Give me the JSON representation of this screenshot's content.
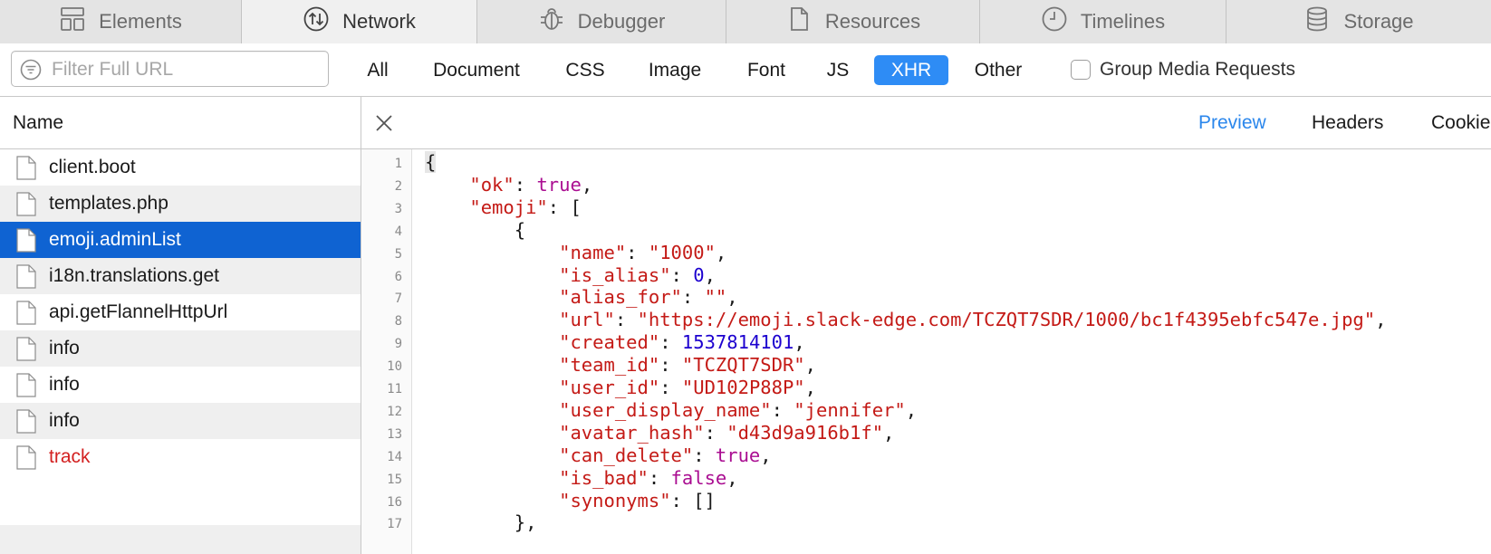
{
  "tabs": [
    {
      "label": "Elements",
      "icon": "elements-icon",
      "active": false
    },
    {
      "label": "Network",
      "icon": "network-icon",
      "active": true
    },
    {
      "label": "Debugger",
      "icon": "debugger-icon",
      "active": false
    },
    {
      "label": "Resources",
      "icon": "resources-icon",
      "active": false
    },
    {
      "label": "Timelines",
      "icon": "timelines-icon",
      "active": false
    },
    {
      "label": "Storage",
      "icon": "storage-icon",
      "active": false
    }
  ],
  "filter": {
    "placeholder": "Filter Full URL",
    "types": [
      "All",
      "Document",
      "CSS",
      "Image",
      "Font",
      "JS",
      "XHR",
      "Other"
    ],
    "active_type": "XHR",
    "group_media_label": "Group Media Requests",
    "group_media_checked": false
  },
  "list": {
    "header": "Name",
    "items": [
      {
        "name": "client.boot",
        "state": "normal"
      },
      {
        "name": "templates.php",
        "state": "normal"
      },
      {
        "name": "emoji.adminList",
        "state": "selected"
      },
      {
        "name": "i18n.translations.get",
        "state": "normal"
      },
      {
        "name": "api.getFlannelHttpUrl",
        "state": "normal"
      },
      {
        "name": "info",
        "state": "normal"
      },
      {
        "name": "info",
        "state": "normal"
      },
      {
        "name": "info",
        "state": "normal"
      },
      {
        "name": "track",
        "state": "error"
      }
    ]
  },
  "detail": {
    "tabs": [
      "Preview",
      "Headers",
      "Cookies"
    ],
    "active_tab": "Preview"
  },
  "code": {
    "line_numbers": [
      "1",
      "2",
      "3",
      "4",
      "5",
      "6",
      "7",
      "8",
      "9",
      "10",
      "11",
      "12",
      "13",
      "14",
      "15",
      "16",
      "17"
    ],
    "lines": [
      [
        {
          "t": "p",
          "v": "{"
        }
      ],
      [
        {
          "t": "p",
          "v": "    "
        },
        {
          "t": "k",
          "v": "\"ok\""
        },
        {
          "t": "p",
          "v": ": "
        },
        {
          "t": "b",
          "v": "true"
        },
        {
          "t": "p",
          "v": ","
        }
      ],
      [
        {
          "t": "p",
          "v": "    "
        },
        {
          "t": "k",
          "v": "\"emoji\""
        },
        {
          "t": "p",
          "v": ": ["
        }
      ],
      [
        {
          "t": "p",
          "v": "        {"
        }
      ],
      [
        {
          "t": "p",
          "v": "            "
        },
        {
          "t": "k",
          "v": "\"name\""
        },
        {
          "t": "p",
          "v": ": "
        },
        {
          "t": "s",
          "v": "\"1000\""
        },
        {
          "t": "p",
          "v": ","
        }
      ],
      [
        {
          "t": "p",
          "v": "            "
        },
        {
          "t": "k",
          "v": "\"is_alias\""
        },
        {
          "t": "p",
          "v": ": "
        },
        {
          "t": "n",
          "v": "0"
        },
        {
          "t": "p",
          "v": ","
        }
      ],
      [
        {
          "t": "p",
          "v": "            "
        },
        {
          "t": "k",
          "v": "\"alias_for\""
        },
        {
          "t": "p",
          "v": ": "
        },
        {
          "t": "s",
          "v": "\"\""
        },
        {
          "t": "p",
          "v": ","
        }
      ],
      [
        {
          "t": "p",
          "v": "            "
        },
        {
          "t": "k",
          "v": "\"url\""
        },
        {
          "t": "p",
          "v": ": "
        },
        {
          "t": "s",
          "v": "\"https://emoji.slack-edge.com/TCZQT7SDR/1000/bc1f4395ebfc547e.jpg\""
        },
        {
          "t": "p",
          "v": ","
        }
      ],
      [
        {
          "t": "p",
          "v": "            "
        },
        {
          "t": "k",
          "v": "\"created\""
        },
        {
          "t": "p",
          "v": ": "
        },
        {
          "t": "n",
          "v": "1537814101"
        },
        {
          "t": "p",
          "v": ","
        }
      ],
      [
        {
          "t": "p",
          "v": "            "
        },
        {
          "t": "k",
          "v": "\"team_id\""
        },
        {
          "t": "p",
          "v": ": "
        },
        {
          "t": "s",
          "v": "\"TCZQT7SDR\""
        },
        {
          "t": "p",
          "v": ","
        }
      ],
      [
        {
          "t": "p",
          "v": "            "
        },
        {
          "t": "k",
          "v": "\"user_id\""
        },
        {
          "t": "p",
          "v": ": "
        },
        {
          "t": "s",
          "v": "\"UD102P88P\""
        },
        {
          "t": "p",
          "v": ","
        }
      ],
      [
        {
          "t": "p",
          "v": "            "
        },
        {
          "t": "k",
          "v": "\"user_display_name\""
        },
        {
          "t": "p",
          "v": ": "
        },
        {
          "t": "s",
          "v": "\"jennifer\""
        },
        {
          "t": "p",
          "v": ","
        }
      ],
      [
        {
          "t": "p",
          "v": "            "
        },
        {
          "t": "k",
          "v": "\"avatar_hash\""
        },
        {
          "t": "p",
          "v": ": "
        },
        {
          "t": "s",
          "v": "\"d43d9a916b1f\""
        },
        {
          "t": "p",
          "v": ","
        }
      ],
      [
        {
          "t": "p",
          "v": "            "
        },
        {
          "t": "k",
          "v": "\"can_delete\""
        },
        {
          "t": "p",
          "v": ": "
        },
        {
          "t": "b",
          "v": "true"
        },
        {
          "t": "p",
          "v": ","
        }
      ],
      [
        {
          "t": "p",
          "v": "            "
        },
        {
          "t": "k",
          "v": "\"is_bad\""
        },
        {
          "t": "p",
          "v": ": "
        },
        {
          "t": "b",
          "v": "false"
        },
        {
          "t": "p",
          "v": ","
        }
      ],
      [
        {
          "t": "p",
          "v": "            "
        },
        {
          "t": "k",
          "v": "\"synonyms\""
        },
        {
          "t": "p",
          "v": ": []"
        }
      ],
      [
        {
          "t": "p",
          "v": "        },"
        }
      ]
    ]
  },
  "colors": {
    "accent": "#2e8cf5",
    "selection": "#0f63d2",
    "error": "#d32121",
    "json_key": "#c41a16",
    "json_number": "#1c00cf",
    "json_bool": "#aa0d91"
  }
}
